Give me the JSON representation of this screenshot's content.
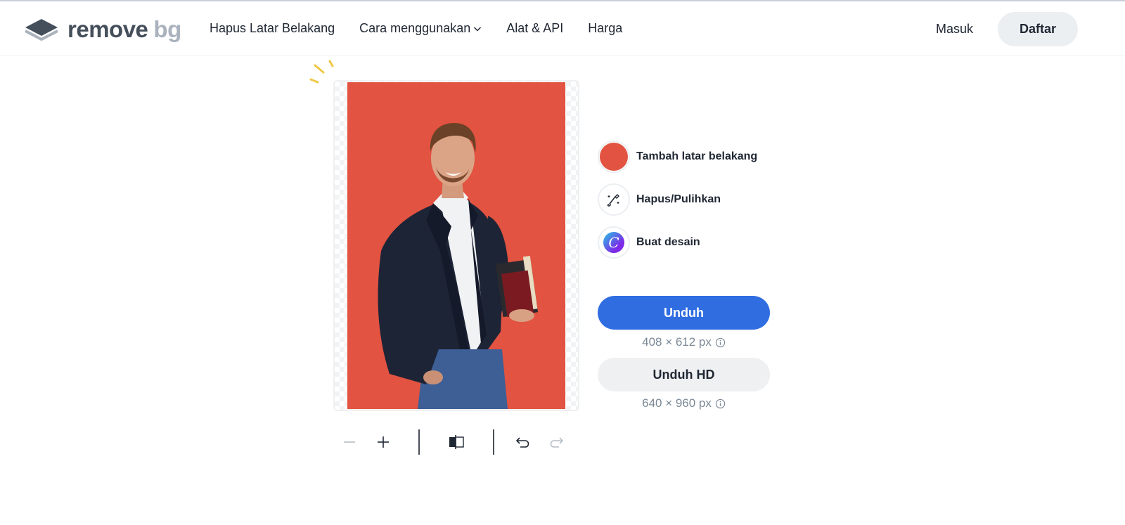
{
  "header": {
    "logo_text": "remove",
    "logo_text_suffix": "bg",
    "nav": [
      {
        "label": "Hapus Latar Belakang"
      },
      {
        "label": "Cara menggunakan"
      },
      {
        "label": "Alat & API"
      },
      {
        "label": "Harga"
      }
    ],
    "login_label": "Masuk",
    "signup_label": "Daftar"
  },
  "editor": {
    "background_color": "#e25341",
    "tools": [
      {
        "label": "Tambah latar belakang",
        "icon": "color-swatch-icon"
      },
      {
        "label": "Hapus/Pulihkan",
        "icon": "magic-brush-icon"
      },
      {
        "label": "Buat desain",
        "icon": "canva-logo-icon"
      }
    ],
    "canva_glyph": "C",
    "download": {
      "label": "Unduh",
      "size": "408 × 612 px"
    },
    "download_hd": {
      "label": "Unduh HD",
      "size": "640 × 960 px"
    }
  },
  "toolbar": {
    "items": [
      "zoom-out-icon",
      "zoom-in-icon",
      "compare-icon",
      "undo-icon",
      "redo-icon"
    ]
  },
  "colors": {
    "primary": "#2f6de1",
    "accent_background": "#e25341",
    "sparkle": "#f2c744"
  }
}
